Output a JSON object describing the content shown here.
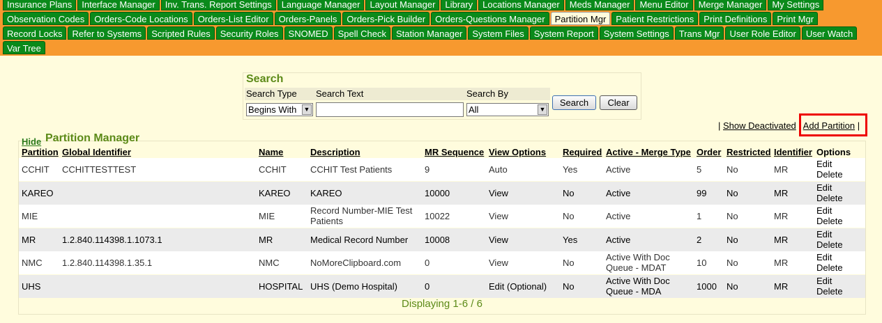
{
  "tabs": {
    "row1": [
      "Insurance Plans",
      "Interface Manager",
      "Inv. Trans. Report Settings",
      "Language Manager",
      "Layout Manager",
      "Library",
      "Locations Manager",
      "Meds Manager",
      "Menu Editor",
      "Merge Manager",
      "My Settings"
    ],
    "row2": [
      "Observation Codes",
      "Orders-Code Locations",
      "Orders-List Editor",
      "Orders-Panels",
      "Orders-Pick Builder",
      "Orders-Questions Manager",
      "Partition Mgr",
      "Patient Restrictions",
      "Print Definitions",
      "Print Mgr"
    ],
    "row3": [
      "Record Locks",
      "Refer to Systems",
      "Scripted Rules",
      "Security Roles",
      "SNOMED",
      "Spell Check",
      "Station Manager",
      "System Files",
      "System Report",
      "System Settings",
      "Trans Mgr",
      "User Role Editor",
      "User Watch"
    ],
    "row4": [
      "Var Tree"
    ],
    "active": "Partition Mgr"
  },
  "search": {
    "title": "Search",
    "type_label": "Search Type",
    "text_label": "Search Text",
    "by_label": "Search By",
    "type_value": "Begins With",
    "text_value": "",
    "by_value": "All",
    "search_button": "Search",
    "clear_button": "Clear"
  },
  "links": {
    "show_deactivated": "Show Deactivated",
    "add_partition": "Add Partition"
  },
  "panel": {
    "hide": "Hide",
    "title": "Partition Manager",
    "footer": "Displaying 1-6 / 6"
  },
  "table": {
    "headers": [
      "Partition",
      "Global Identifier",
      "Name",
      "Description",
      "MR Sequence",
      "View Options",
      "Required",
      "Active - Merge Type",
      "Order",
      "Restricted",
      "Identifier",
      "Options"
    ],
    "rows": [
      {
        "partition": "CCHIT",
        "global_id": "CCHITTESTTEST",
        "name": "CCHIT",
        "description": "CCHIT Test Patients",
        "mr_seq": "9",
        "view": "Auto",
        "required": "Yes",
        "active": "Active",
        "order": "5",
        "restricted": "No",
        "identifier": "MR",
        "edit": "Edit",
        "delete": "Delete"
      },
      {
        "partition": "KAREO",
        "global_id": "",
        "name": "KAREO",
        "description": "KAREO",
        "mr_seq": "10000",
        "view": "View",
        "required": "No",
        "active": "Active",
        "order": "99",
        "restricted": "No",
        "identifier": "MR",
        "edit": "Edit",
        "delete": "Delete"
      },
      {
        "partition": "MIE",
        "global_id": "",
        "name": "MIE",
        "description": "Record Number-MIE Test Patients",
        "mr_seq": "10022",
        "view": "View",
        "required": "No",
        "active": "Active",
        "order": "1",
        "restricted": "No",
        "identifier": "MR",
        "edit": "Edit",
        "delete": "Delete"
      },
      {
        "partition": "MR",
        "global_id": "1.2.840.114398.1.1073.1",
        "name": "MR",
        "description": "Medical Record Number",
        "mr_seq": "10008",
        "view": "View",
        "required": "Yes",
        "active": "Active",
        "order": "2",
        "restricted": "No",
        "identifier": "MR",
        "edit": "Edit",
        "delete": "Delete"
      },
      {
        "partition": "NMC",
        "global_id": "1.2.840.114398.1.35.1",
        "name": "NMC",
        "description": "NoMoreClipboard.com",
        "mr_seq": "0",
        "view": "View",
        "required": "No",
        "active": "Active With Doc Queue - MDAT",
        "order": "10",
        "restricted": "No",
        "identifier": "MR",
        "edit": "Edit",
        "delete": "Delete"
      },
      {
        "partition": "UHS",
        "global_id": "",
        "name": "HOSPITAL",
        "description": "UHS (Demo Hospital)",
        "mr_seq": "0",
        "view": "Edit (Optional)",
        "required": "No",
        "active": "Active With Doc Queue - MDA",
        "order": "1000",
        "restricted": "No",
        "identifier": "MR",
        "edit": "Edit",
        "delete": "Delete"
      }
    ]
  },
  "colors": {
    "tab_green": "#0a8a1a",
    "top_orange": "#f7992f",
    "page_bg": "#fffcdd",
    "title_green": "#5c8a18",
    "highlight_red": "#ee0000"
  }
}
